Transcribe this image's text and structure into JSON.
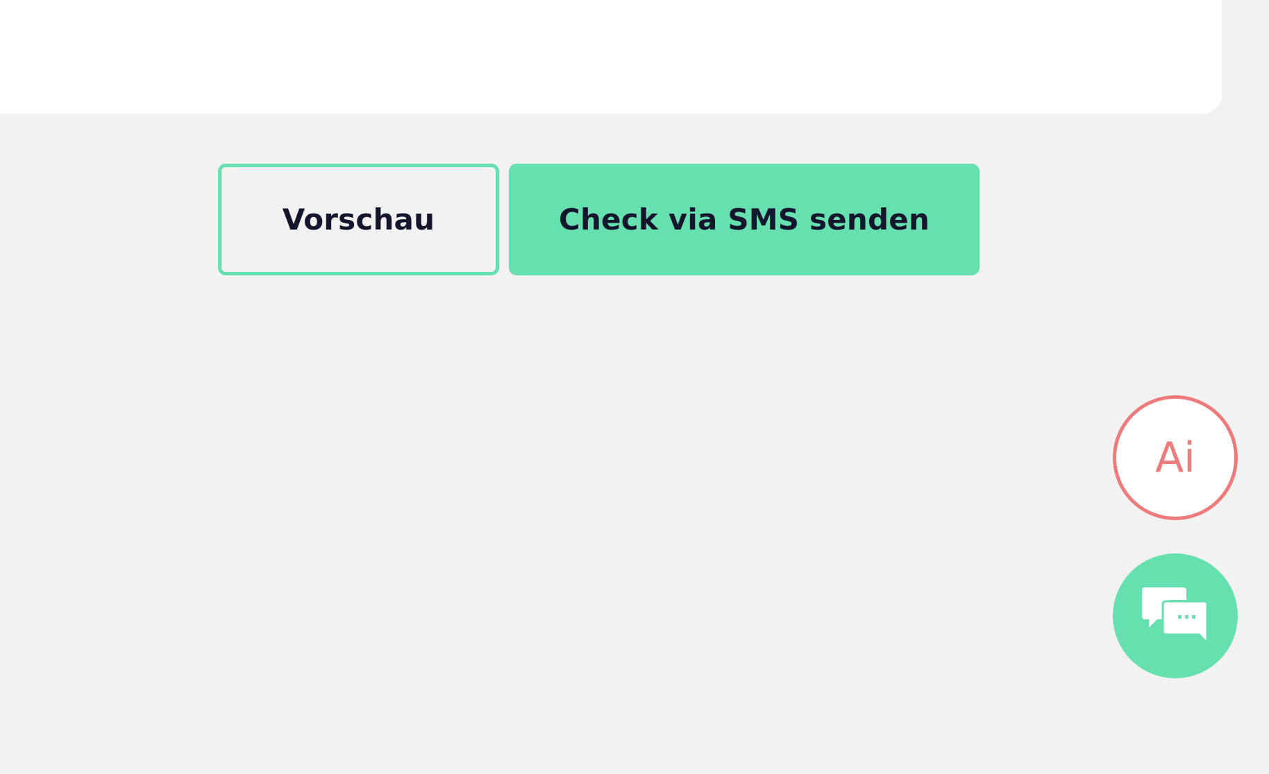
{
  "colors": {
    "background": "#f2f2f2",
    "card": "#ffffff",
    "accent_green": "#66e0ae",
    "accent_red": "#ee7b7b",
    "text_dark": "#14162e"
  },
  "actions": {
    "preview_label": "Vorschau",
    "send_label": "Check via SMS senden"
  },
  "fabs": {
    "ai_label": "Ai",
    "ai_icon": "ai-assistant-icon",
    "chat_icon": "chat-bubbles-icon"
  }
}
